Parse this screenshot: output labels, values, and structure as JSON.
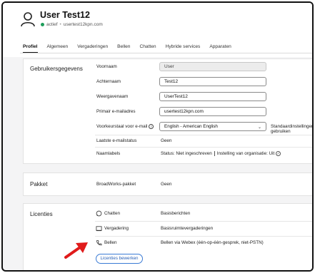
{
  "header": {
    "name": "User Test12",
    "status": "actief",
    "email": "usertest12kpn.com"
  },
  "tabs": [
    {
      "label": "Profiel",
      "active": true
    },
    {
      "label": "Algemeen"
    },
    {
      "label": "Vergaderingen"
    },
    {
      "label": "Bellen"
    },
    {
      "label": "Chatten"
    },
    {
      "label": "Hybride services"
    },
    {
      "label": "Apparaten"
    }
  ],
  "user_data": {
    "section_title": "Gebruikersgegevens",
    "first_name_label": "Voornaam",
    "first_name_value": "User",
    "last_name_label": "Achternaam",
    "last_name_value": "Test12",
    "display_name_label": "Weergavenaam",
    "display_name_value": "UserTest12",
    "primary_email_label": "Primair e-mailadres",
    "primary_email_value": "usertest12kpn.com",
    "email_language_label": "Voorkeurstaal voor e-mail",
    "email_language_value": "English - American English",
    "default_settings_label": "Standaardinstellingen gebruiken",
    "last_email_status_label": "Laatste e-mailstatus",
    "last_email_status_value": "Geen",
    "name_labels_label": "Naamlabels",
    "name_labels_status": "Status:  Niet ingeschreven",
    "name_labels_org": "Instelling van organisatie:  Uit"
  },
  "package": {
    "section_title": "Pakket",
    "label": "BroadWorks-pakket",
    "value": "Geen"
  },
  "licenses": {
    "section_title": "Licenties",
    "items": [
      {
        "label": "Chatten",
        "value": "Basisberichten",
        "icon": "chat-icon"
      },
      {
        "label": "Vergadering",
        "value": "Basisruimtevergaderingen",
        "icon": "meeting-icon"
      },
      {
        "label": "Bellen",
        "value": "Bellen via Webex (één-op-één-gesprek, niet-PSTN)",
        "icon": "phone-icon"
      }
    ],
    "edit_button": "Licenties bewerken"
  },
  "colors": {
    "status_active": "#1e9d5a",
    "annotation_arrow": "#e01b1b",
    "link_blue": "#2a62b8"
  }
}
